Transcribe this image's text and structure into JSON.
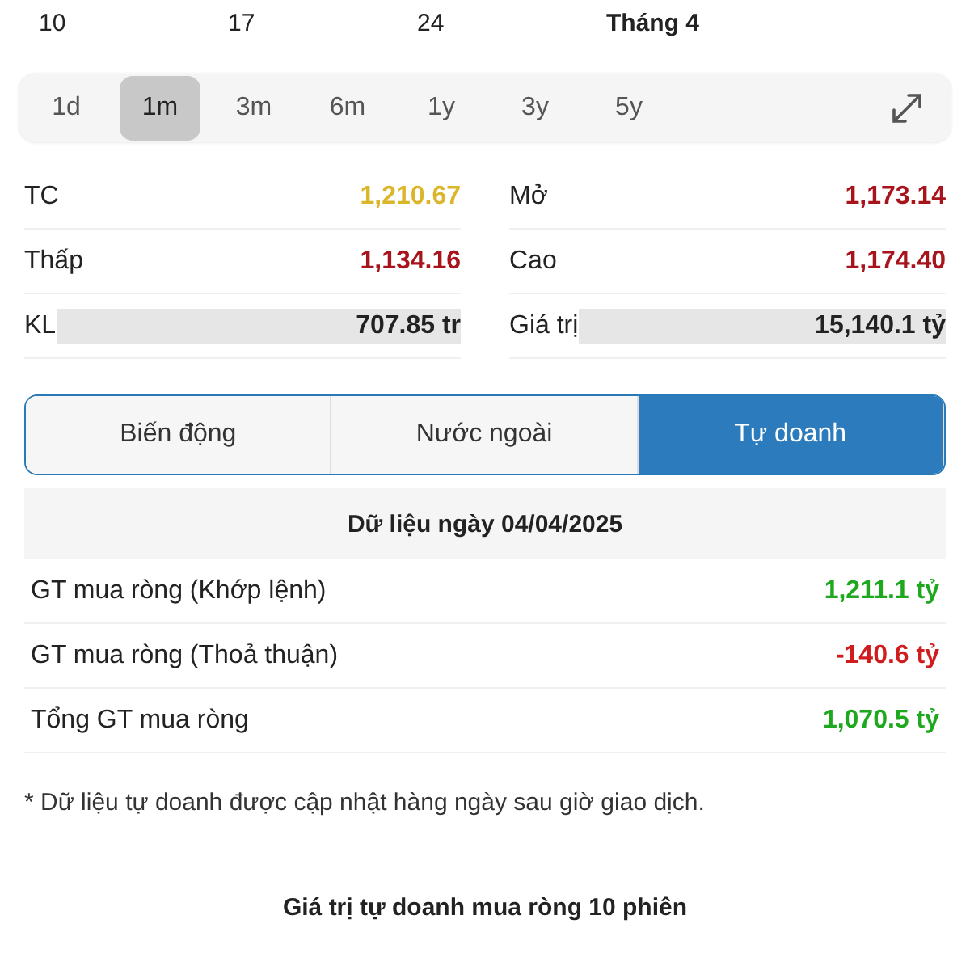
{
  "axis_labels": [
    {
      "label": "10",
      "bold": false
    },
    {
      "label": "17",
      "bold": false
    },
    {
      "label": "24",
      "bold": false
    },
    {
      "label": "Tháng 4",
      "bold": true
    }
  ],
  "periods": [
    {
      "label": "1d",
      "selected": false
    },
    {
      "label": "1m",
      "selected": true
    },
    {
      "label": "3m",
      "selected": false
    },
    {
      "label": "6m",
      "selected": false
    },
    {
      "label": "1y",
      "selected": false
    },
    {
      "label": "3y",
      "selected": false
    },
    {
      "label": "5y",
      "selected": false
    }
  ],
  "stats": [
    {
      "label": "TC",
      "value": "1,210.67",
      "color": "#dcb62a"
    },
    {
      "label": "Mở",
      "value": "1,173.14",
      "color": "#a8141c"
    },
    {
      "label": "Thấp",
      "value": "1,134.16",
      "color": "#a8141c"
    },
    {
      "label": "Cao",
      "value": "1,174.40",
      "color": "#a8141c"
    },
    {
      "label": "KL",
      "value": "707.85 tr",
      "color": "#222222",
      "highlighted": true
    },
    {
      "label": "Giá trị",
      "value": "15,140.1 tỷ",
      "color": "#222222",
      "highlighted": true
    }
  ],
  "tabs": [
    {
      "label": "Biến động",
      "selected": false
    },
    {
      "label": "Nước ngoài",
      "selected": false
    },
    {
      "label": "Tự doanh",
      "selected": true
    }
  ],
  "date_header": "Dữ liệu ngày 04/04/2025",
  "rows": [
    {
      "label": "GT mua ròng (Khớp lệnh)",
      "value": "1,211.1 tỷ",
      "color": "#1ea81e"
    },
    {
      "label": "GT mua ròng (Thoả thuận)",
      "value": "-140.6 tỷ",
      "color": "#d01c1c"
    },
    {
      "label": "Tổng GT mua ròng",
      "value": "1,070.5 tỷ",
      "color": "#1ea81e"
    }
  ],
  "note": "* Dữ liệu tự doanh được cập nhật hàng ngày sau giờ giao dịch.",
  "chart_title": "Giá trị tự doanh mua ròng 10 phiên"
}
